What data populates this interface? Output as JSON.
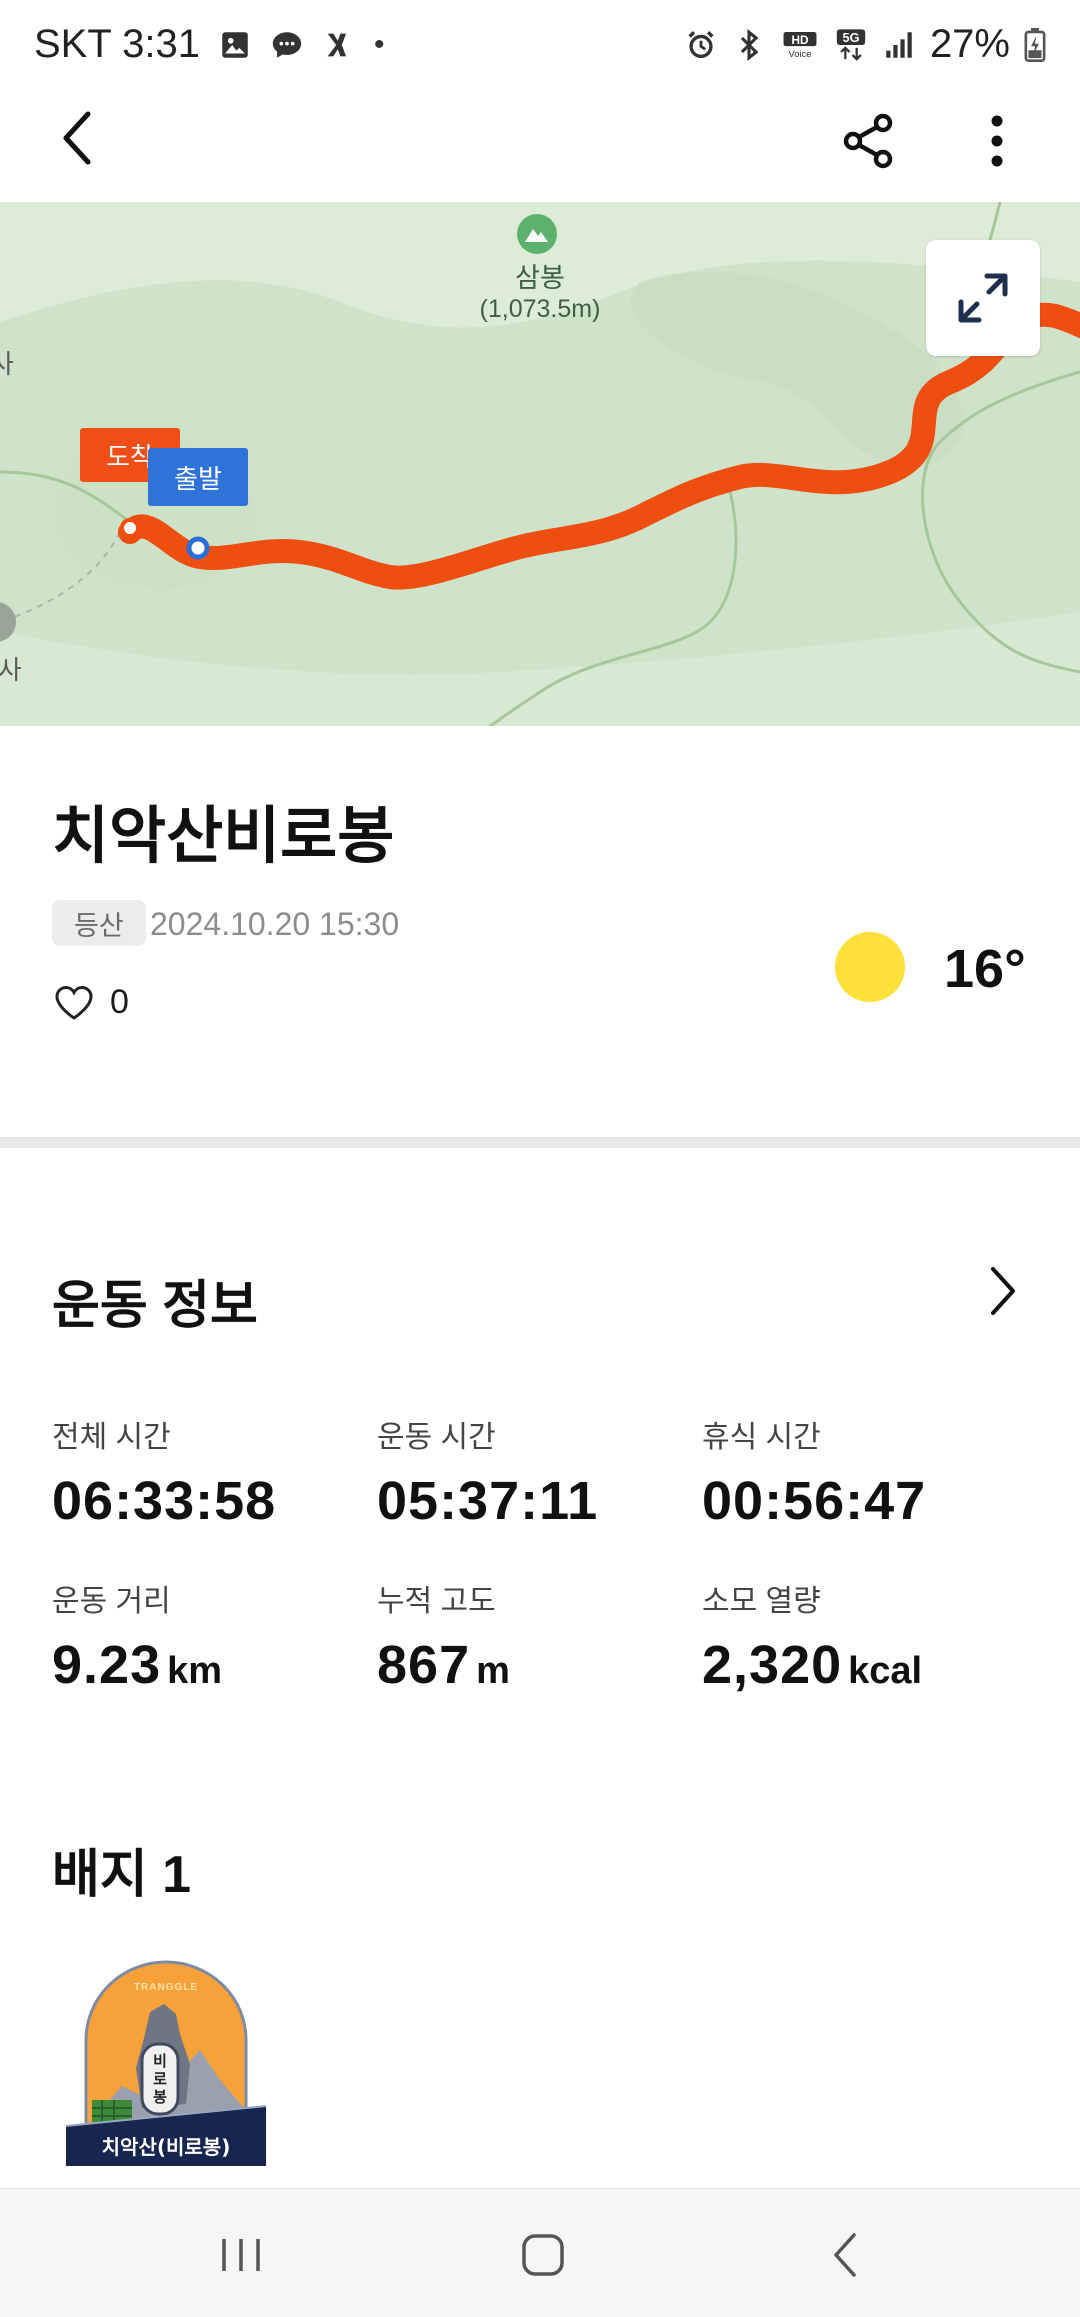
{
  "status_bar": {
    "carrier_time": "SKT 3:31",
    "battery": "27%",
    "icons": [
      "image-icon",
      "chat-icon",
      "flash-icon",
      "dot-icon",
      "alarm-icon",
      "bluetooth-icon",
      "hd-voice-icon",
      "5g-icon",
      "signal-icon",
      "battery-icon"
    ]
  },
  "header": {
    "icons": [
      "back-icon",
      "share-icon",
      "more-icon"
    ]
  },
  "map": {
    "peak_name": "삼봉",
    "peak_elevation": "(1,073.5m)",
    "end_marker": "도착",
    "start_marker": "출발",
    "edge_label_left_top": "사",
    "edge_label_left_bottom": "명사",
    "route_color": "#f04e0f"
  },
  "activity": {
    "title": "치악산비로봉",
    "tag": "등산",
    "datetime": "2024.10.20 15:30",
    "likes": "0",
    "temperature": "16°",
    "weather_icon": "sun-icon"
  },
  "exercise_info": {
    "title": "운동 정보",
    "stats": [
      {
        "label": "전체 시간",
        "value": "06:33:58",
        "unit": ""
      },
      {
        "label": "운동 시간",
        "value": "05:37:11",
        "unit": ""
      },
      {
        "label": "휴식 시간",
        "value": "00:56:47",
        "unit": ""
      },
      {
        "label": "운동 거리",
        "value": "9.23",
        "unit": "km"
      },
      {
        "label": "누적 고도",
        "value": "867",
        "unit": "m"
      },
      {
        "label": "소모 열량",
        "value": "2,320",
        "unit": "kcal"
      }
    ]
  },
  "badges": {
    "title": "배지 1",
    "items": [
      {
        "name": "치악산(비로봉)",
        "top_text": "TRANGGLE",
        "tower_text": "비로봉"
      }
    ]
  },
  "nav_bar": {
    "icons": [
      "recent-apps-icon",
      "home-icon",
      "nav-back-icon"
    ]
  }
}
